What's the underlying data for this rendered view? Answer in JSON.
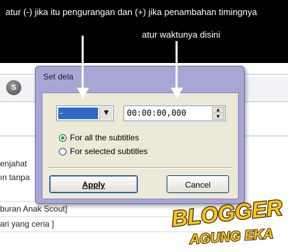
{
  "annotations": {
    "top": "atur (-) jika itu pengurangan dan (+) jika penambahan timingnya",
    "right": "atur waktunya disini"
  },
  "background_app": {
    "toolbar_button": "S",
    "lines": [
      "enjahat",
      "ın tanpa",
      "buran  Anak Scout]",
      "ari yang ceria ]"
    ]
  },
  "dialog": {
    "title": "Set dela",
    "sign_value": "-",
    "time_value": "00:00:00,000",
    "options": [
      {
        "label": "For all the subtitles",
        "checked": true
      },
      {
        "label": "For selected subtitles",
        "checked": false
      }
    ],
    "apply_label": "Apply",
    "cancel_label": "Cancel"
  },
  "logo": {
    "line1": "BLOGGER",
    "line2": "AGUNG EKA"
  },
  "colors": {
    "dialog_frame": "#a8a6d4",
    "selection": "#3169c6",
    "logo_yellow": "#f6c90e",
    "logo_text": "#3f1f1f"
  },
  "icons": {
    "combo_arrow": "triangle-down",
    "spin_up": "triangle-up",
    "spin_down": "triangle-down"
  }
}
